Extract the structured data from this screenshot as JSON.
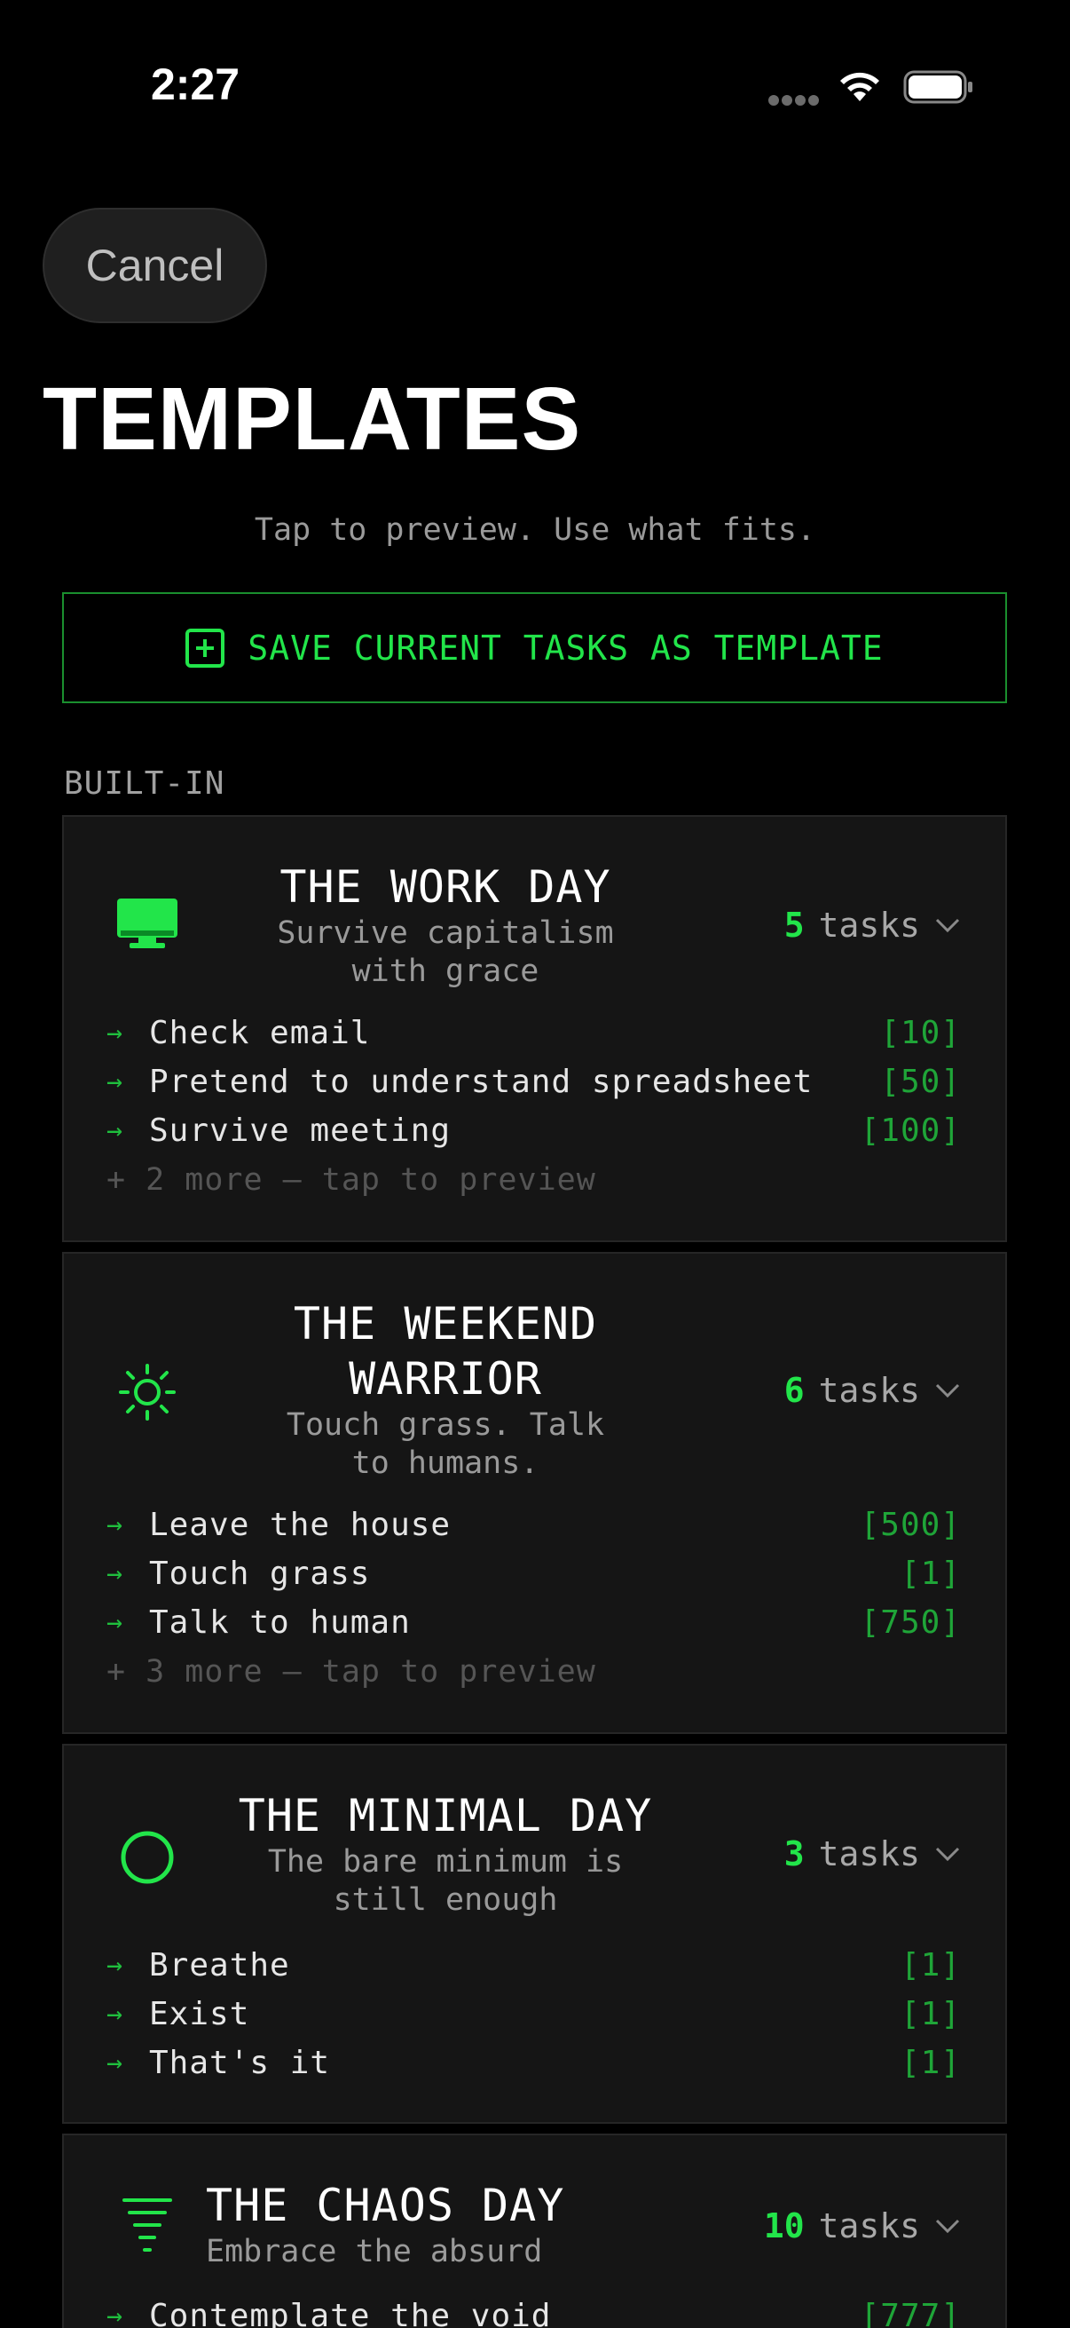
{
  "status": {
    "time": "2:27"
  },
  "cancel_label": "Cancel",
  "title": "TEMPLATES",
  "subtitle": "Tap to preview. Use what fits.",
  "save_button": {
    "label": "SAVE CURRENT TASKS AS TEMPLATE",
    "icon": "plus-square-icon"
  },
  "section_label": "BUILT-IN",
  "colors": {
    "accent": "#22e54a",
    "background": "#000000",
    "card": "#151515"
  },
  "templates": [
    {
      "icon": "monitor-icon",
      "title": "THE WORK DAY",
      "subtitle_line1": "Survive capitalism",
      "subtitle_line2": "with grace",
      "count": "5",
      "count_label": "tasks",
      "tasks": [
        {
          "name": "Check email",
          "points": "[10]"
        },
        {
          "name": "Pretend to understand spreadsheet",
          "points": "[50]"
        },
        {
          "name": "Survive meeting",
          "points": "[100]"
        }
      ],
      "more": "+ 2 more — tap to preview"
    },
    {
      "icon": "sun-icon",
      "title_line1": "THE WEEKEND",
      "title_line2": "WARRIOR",
      "subtitle_line1": "Touch grass. Talk",
      "subtitle_line2": "to humans.",
      "count": "6",
      "count_label": "tasks",
      "tasks": [
        {
          "name": "Leave the house",
          "points": "[500]"
        },
        {
          "name": "Touch grass",
          "points": "[1]"
        },
        {
          "name": "Talk to human",
          "points": "[750]"
        }
      ],
      "more": "+ 3 more — tap to preview"
    },
    {
      "icon": "circle-icon",
      "title": "THE MINIMAL DAY",
      "subtitle_line1": "The bare minimum is",
      "subtitle_line2": "still enough",
      "count": "3",
      "count_label": "tasks",
      "tasks": [
        {
          "name": "Breathe",
          "points": "[1]"
        },
        {
          "name": "Exist",
          "points": "[1]"
        },
        {
          "name": "That's it",
          "points": "[1]"
        }
      ]
    },
    {
      "icon": "tornado-icon",
      "title": "THE CHAOS DAY",
      "subtitle_line1": "Embrace the absurd",
      "count": "10",
      "count_label": "tasks",
      "tasks": [
        {
          "name": "Contemplate the void",
          "points": "[777]"
        }
      ]
    }
  ]
}
